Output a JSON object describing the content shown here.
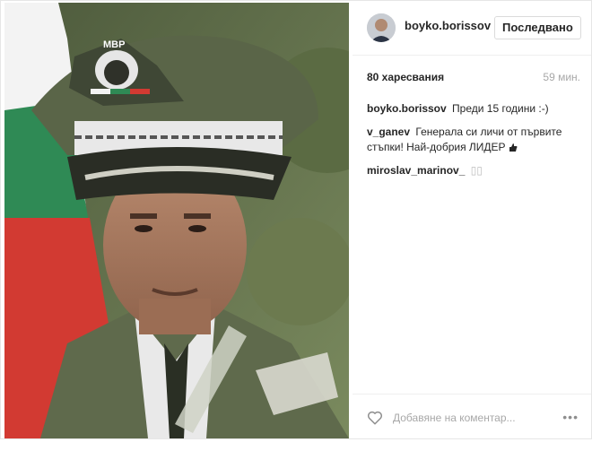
{
  "post": {
    "username": "boyko.borissov",
    "follow_label": "Последвано",
    "likes": "80 харесвания",
    "time": "59 мин.",
    "comments": [
      {
        "user": "boyko.borissov",
        "text": "Преди 15 години :-)"
      },
      {
        "user": "v_ganev",
        "text": "Генерала си личи от първите стъпки! Най-добрия ЛИДЕР"
      },
      {
        "user": "miroslav_marinov_",
        "text": "▯▯"
      }
    ],
    "add_comment_placeholder": "Добавяне на коментар...",
    "more_label": "•••"
  },
  "photo": {
    "cap_badge_text": "МВР"
  },
  "icons": {
    "like": "heart-outline-icon",
    "more": "more-options-icon",
    "comment_emoji": "thumbs-up-icon"
  },
  "colors": {
    "flag_white": "#f3f3f3",
    "flag_green": "#2f8a55",
    "flag_red": "#d23a32",
    "uniform": "#5f6a4c"
  }
}
